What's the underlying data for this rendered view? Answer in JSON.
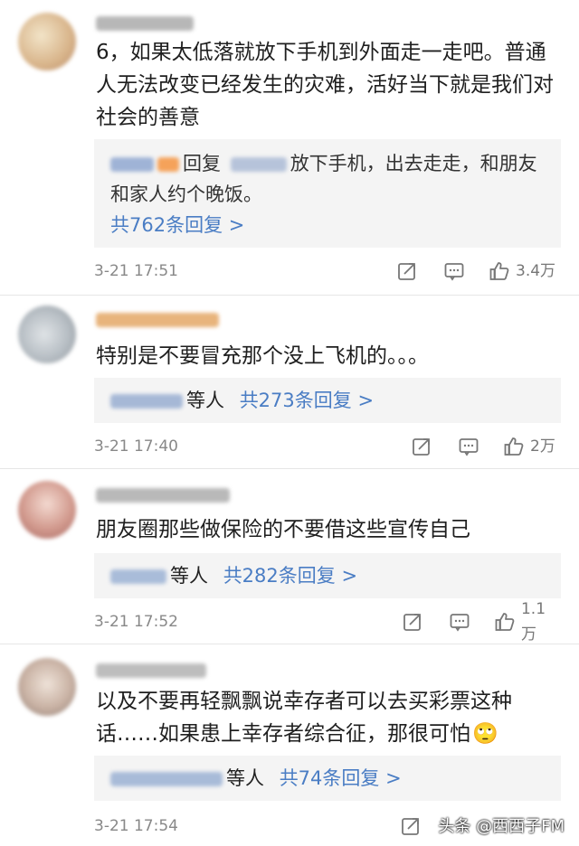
{
  "comments": [
    {
      "text": "6，如果太低落就放下手机到外面走一走吧。普通人无法改变已经发生的灾难，活好当下就是我们对社会的善意",
      "reply_prefix": "回复",
      "reply_text_1": "放下手机，出去走走，和朋友",
      "reply_text_2": "和家人约个晚饭。",
      "reply_summary": "共762条回复 >",
      "time": "3-21 17:51",
      "likes": "3.4万"
    },
    {
      "text": "特别是不要冒充那个没上飞机的。。。",
      "reply_others": "等人",
      "reply_summary": "共273条回复 >",
      "time": "3-21 17:40",
      "likes": "2万"
    },
    {
      "text": "朋友圈那些做保险的不要借这些宣传自己",
      "reply_others": "等人",
      "reply_summary": "共282条回复 >",
      "time": "3-21 17:52",
      "likes": "1.1万"
    },
    {
      "text": "以及不要再轻飘飘说幸存者可以去买彩票这种话……如果患上幸存者综合征，那很可怕",
      "reply_others": "等人",
      "reply_summary": "共74条回复 >",
      "time": "3-21 17:54",
      "likes": ""
    }
  ],
  "watermark": "头条 @西西子FM",
  "emoji": "🙄",
  "icons": {
    "share": "share-icon",
    "comment": "comment-icon",
    "like": "thumbs-up-icon"
  },
  "colors": {
    "link_blue": "#4a7dc4",
    "reply_bg": "#f4f4f4",
    "meta_gray": "#888888"
  }
}
